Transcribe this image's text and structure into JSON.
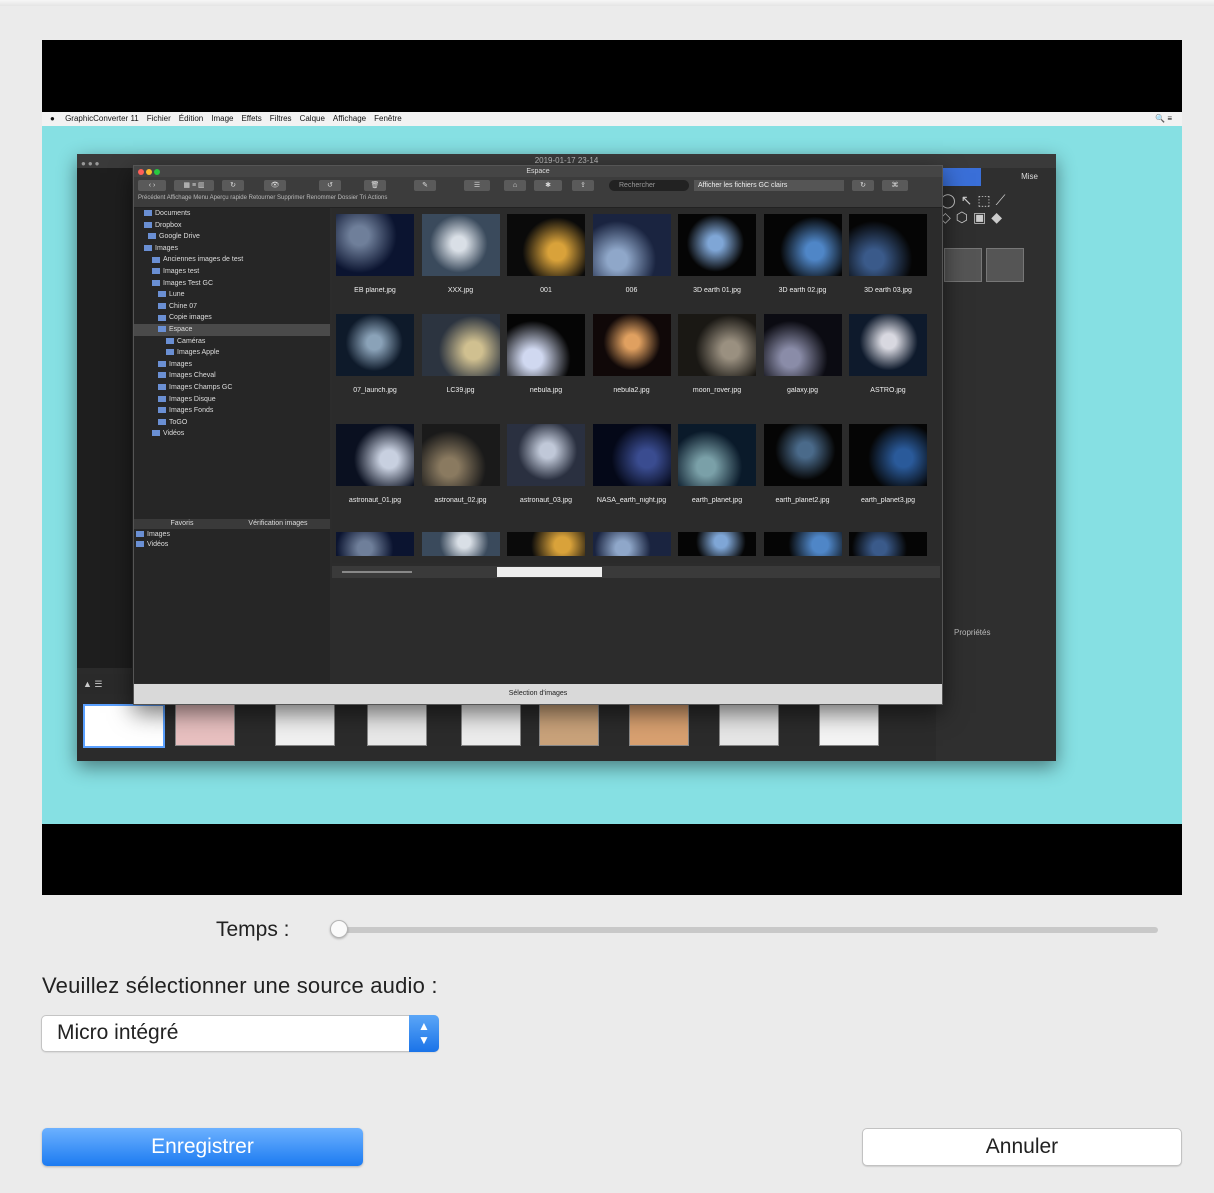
{
  "preview": {
    "menubar_left": [
      "GraphicConverter 11",
      "Fichier",
      "Édition",
      "Image",
      "Effets",
      "Filtres",
      "Calque",
      "Affichage",
      "Fenêtre"
    ],
    "capture_title": "2019-01-17 23-14",
    "image_browser": {
      "title": "Espace",
      "search_placeholder": "Rechercher",
      "field_value": "Afficher les fichiers GC clairs",
      "toolbar_labels": "Précédent   Affichage   Menu   Aperçu rapide   Retourner   Supprimer   Renommer   Dossier   Tri   Actions",
      "sidebar_items": [
        "Documents",
        "Dropbox",
        "Google Drive",
        "Images",
        "Anciennes images de test",
        "Images test",
        "Images Test GC",
        "Lune",
        "Chine 07",
        "Copie images",
        "Espace",
        "Caméras",
        "Images Apple",
        "Images",
        "Images Cheval",
        "Images Champs GC",
        "Images Disque",
        "Images Fonds",
        "ToGO",
        "Vidéos"
      ],
      "sidebar_tabs": [
        "Favoris",
        "Vérification images"
      ],
      "library_items": [
        "Images",
        "Vidéos"
      ],
      "captions": [
        [
          "EB planet.jpg",
          "XXX.jpg",
          "001",
          "006",
          "3D earth 01.jpg",
          "3D earth 02.jpg",
          "3D earth 03.jpg"
        ],
        [
          "07_launch.jpg",
          "LC39.jpg",
          "nebula.jpg",
          "nebula2.jpg",
          "moon_rover.jpg",
          "galaxy.jpg",
          "ASTRO.jpg"
        ],
        [
          "astronaut_01.jpg",
          "astronaut_02.jpg",
          "astronaut_03.jpg",
          "NASA_earth_night.jpg",
          "earth_planet.jpg",
          "earth_planet2.jpg",
          "earth_planet3.jpg"
        ]
      ],
      "footer": "Sélection d'images"
    },
    "colors": {
      "background": "#86e0e3",
      "accent": "#1c7bf1"
    }
  },
  "form": {
    "temps_label": "Temps :",
    "temps_position": 0,
    "audio_label": "Veuillez sélectionner une source audio :",
    "audio_select_value": "Micro intégré",
    "record_button": "Enregistrer",
    "cancel_button": "Annuler"
  }
}
